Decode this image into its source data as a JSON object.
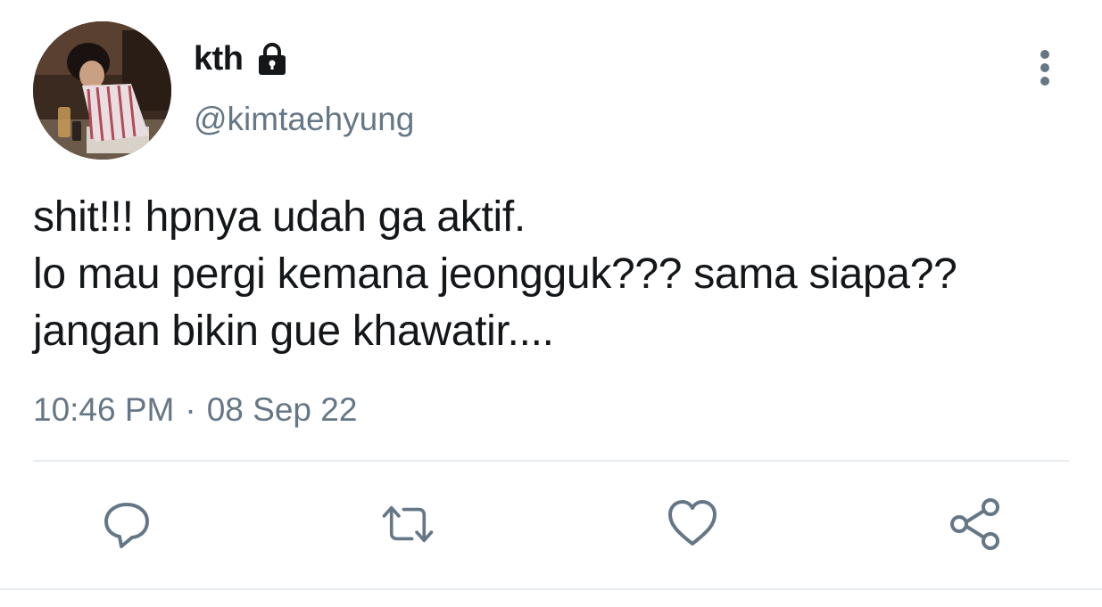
{
  "user": {
    "display_name": "kth",
    "handle": "@kimtaehyung",
    "protected_icon": "lock-icon",
    "avatar": "profile-photo"
  },
  "tweet": {
    "text": "shit!!! hpnya udah ga aktif.\nlo mau pergi kemana jeongguk??? sama siapa?? jangan bikin gue khawatir....",
    "time": "10:46 PM",
    "separator": "·",
    "date": "08 Sep 22"
  },
  "actions": [
    {
      "name": "reply",
      "icon": "speech-bubble-icon"
    },
    {
      "name": "retweet",
      "icon": "retweet-icon"
    },
    {
      "name": "like",
      "icon": "heart-icon"
    },
    {
      "name": "share",
      "icon": "share-icon"
    }
  ],
  "colors": {
    "text_primary": "#14171a",
    "text_secondary": "#657786",
    "icon": "#657786",
    "divider": "#e6ecf0"
  }
}
